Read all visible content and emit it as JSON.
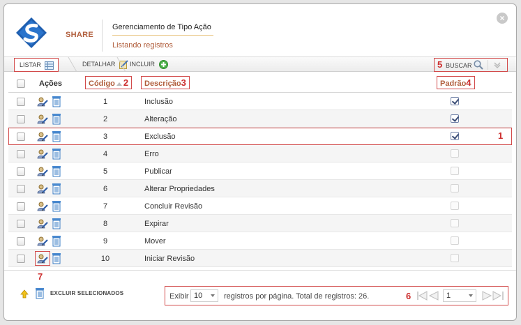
{
  "header": {
    "brand": "SHARE",
    "title": "Gerenciamento de Tipo Ação",
    "subtitle": "Listando registros"
  },
  "toolbar": {
    "tabs": [
      {
        "label": "LISTAR"
      },
      {
        "label": "DETALHAR"
      },
      {
        "label": "INCLUIR"
      }
    ],
    "search_label": "BUSCAR",
    "search_callout": "5"
  },
  "grid": {
    "headers": {
      "acoes": "Ações",
      "codigo": "Código",
      "codigo_callout": "2",
      "descricao": "Descrição",
      "descricao_callout": "3",
      "padrao": "Padrão",
      "padrao_callout": "4"
    },
    "highlight_callout": "1",
    "rows": [
      {
        "code": "1",
        "desc": "Inclusão",
        "padrao": true
      },
      {
        "code": "2",
        "desc": "Alteração",
        "padrao": true
      },
      {
        "code": "3",
        "desc": "Exclusão",
        "padrao": true
      },
      {
        "code": "4",
        "desc": "Erro",
        "padrao": false
      },
      {
        "code": "5",
        "desc": "Publicar",
        "padrao": false
      },
      {
        "code": "6",
        "desc": "Alterar Propriedades",
        "padrao": false
      },
      {
        "code": "7",
        "desc": "Concluir Revisão",
        "padrao": false
      },
      {
        "code": "8",
        "desc": "Expirar",
        "padrao": false
      },
      {
        "code": "9",
        "desc": "Mover",
        "padrao": false
      },
      {
        "code": "10",
        "desc": "Iniciar Revisão",
        "padrao": false
      }
    ]
  },
  "footer": {
    "edit_callout": "7",
    "bulk_delete_label": "EXCLUIR SELECIONADOS",
    "pager": {
      "show_label": "Exibir",
      "page_size": "10",
      "info": "registros por página. Total de registros: 26.",
      "callout": "6",
      "current_page": "1"
    }
  },
  "colors": {
    "accent": "#b05d3b",
    "callout": "#cc2d2d",
    "annotation_border": "#d24a4a"
  }
}
